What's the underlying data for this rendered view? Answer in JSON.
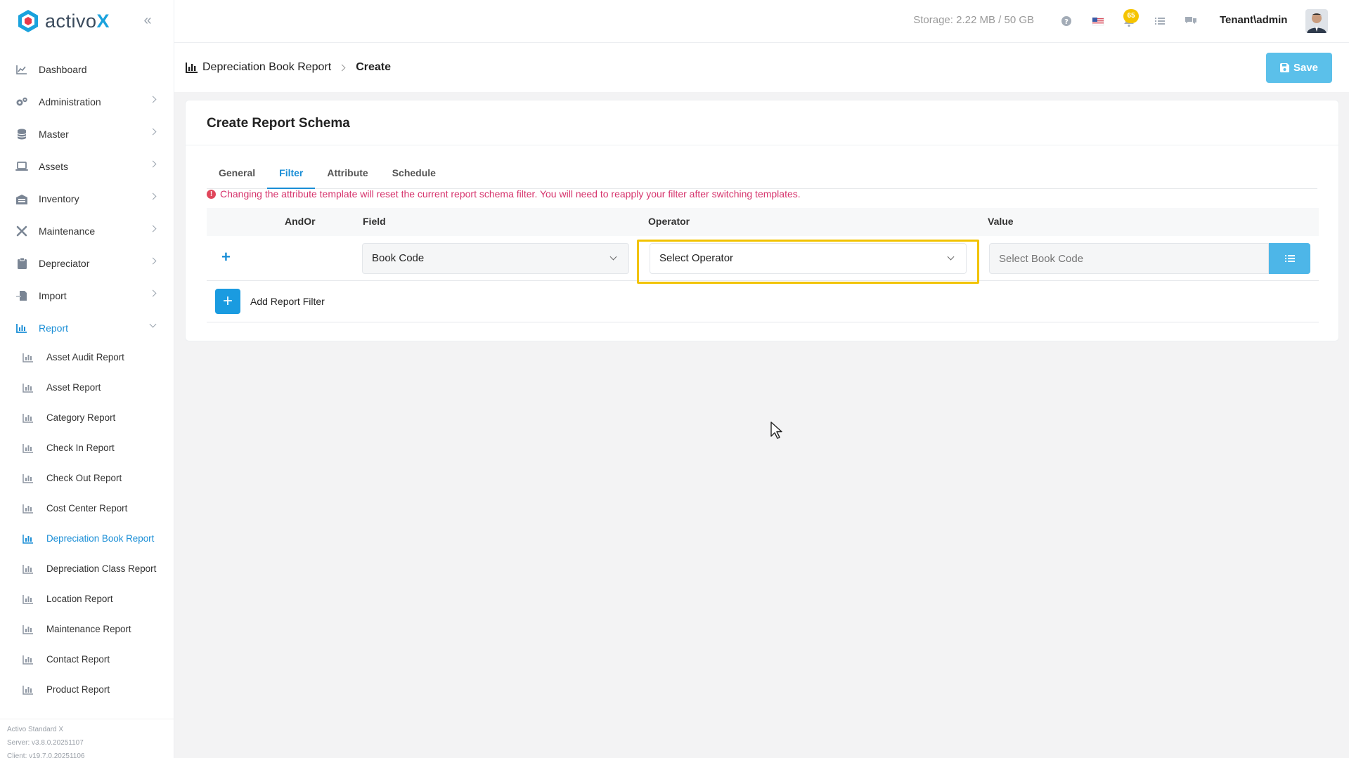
{
  "brand": {
    "name_part1": "activo",
    "name_part2": "X"
  },
  "sidebar": {
    "items": [
      {
        "label": "Dashboard",
        "icon": "chart-line-icon",
        "has_children": false
      },
      {
        "label": "Administration",
        "icon": "gears-icon",
        "has_children": true
      },
      {
        "label": "Master",
        "icon": "database-icon",
        "has_children": true
      },
      {
        "label": "Assets",
        "icon": "laptop-icon",
        "has_children": true
      },
      {
        "label": "Inventory",
        "icon": "warehouse-icon",
        "has_children": true
      },
      {
        "label": "Maintenance",
        "icon": "tools-icon",
        "has_children": true
      },
      {
        "label": "Depreciator",
        "icon": "clipboard-icon",
        "has_children": true
      },
      {
        "label": "Import",
        "icon": "file-import-icon",
        "has_children": true
      },
      {
        "label": "Report",
        "icon": "bar-chart-icon",
        "has_children": true,
        "open": true
      }
    ],
    "report_sub": [
      {
        "label": "Asset Audit Report"
      },
      {
        "label": "Asset Report"
      },
      {
        "label": "Category Report"
      },
      {
        "label": "Check In Report"
      },
      {
        "label": "Check Out Report"
      },
      {
        "label": "Cost Center Report"
      },
      {
        "label": "Depreciation Book Report",
        "active": true
      },
      {
        "label": "Depreciation Class Report"
      },
      {
        "label": "Location Report"
      },
      {
        "label": "Maintenance Report"
      },
      {
        "label": "Contact Report"
      },
      {
        "label": "Product Report"
      }
    ],
    "version": {
      "edition": "Activo Standard X",
      "server": "Server: v3.8.0.20251107",
      "client": "Client: v19.7.0.20251106"
    }
  },
  "topbar": {
    "storage": "Storage: 2.22 MB / 50 GB",
    "notification_count": "65",
    "user": "Tenant\\admin"
  },
  "header": {
    "breadcrumb_parent": "Depreciation Book Report",
    "breadcrumb_current": "Create",
    "save_label": "Save"
  },
  "card": {
    "title": "Create Report Schema",
    "tabs": [
      "General",
      "Filter",
      "Attribute",
      "Schedule"
    ],
    "active_tab": "Filter",
    "warning": "Changing the attribute template will reset the current report schema filter. You will need to reapply your filter after switching templates.",
    "columns": {
      "andor": "AndOr",
      "field": "Field",
      "operator": "Operator",
      "value": "Value"
    },
    "row": {
      "field_value": "Book Code",
      "operator_value": "Select Operator",
      "value_placeholder": "Select Book Code"
    },
    "add_filter_label": "Add Report Filter"
  },
  "colors": {
    "accent": "#1a8ed6",
    "save": "#5bc0ea",
    "highlight": "#f2c300",
    "warning": "#d6336c"
  }
}
